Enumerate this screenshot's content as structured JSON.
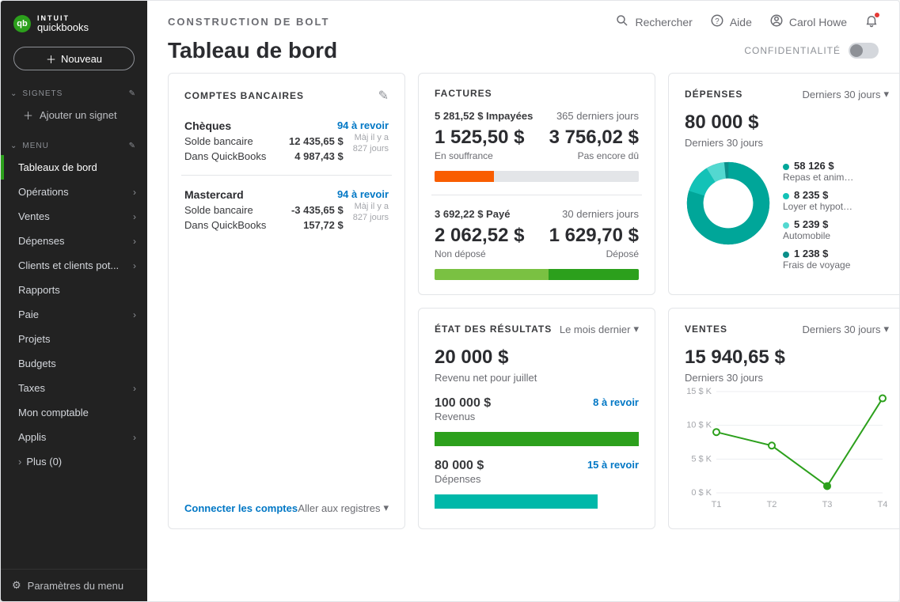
{
  "brand": {
    "line1": "INTUIT",
    "line2": "quickbooks",
    "mark": "qb"
  },
  "sidebar": {
    "new_label": "Nouveau",
    "bookmarks_label": "SIGNETS",
    "add_bookmark": "Ajouter un signet",
    "menu_label": "MENU",
    "items": [
      {
        "label": "Tableaux de bord",
        "chev": false,
        "active": true
      },
      {
        "label": "Opérations",
        "chev": true
      },
      {
        "label": "Ventes",
        "chev": true
      },
      {
        "label": "Dépenses",
        "chev": true
      },
      {
        "label": "Clients et clients pot...",
        "chev": true
      },
      {
        "label": "Rapports",
        "chev": false
      },
      {
        "label": "Paie",
        "chev": true
      },
      {
        "label": "Projets",
        "chev": false
      },
      {
        "label": "Budgets",
        "chev": false
      },
      {
        "label": "Taxes",
        "chev": true
      },
      {
        "label": "Mon comptable",
        "chev": false
      },
      {
        "label": "Applis",
        "chev": true
      }
    ],
    "more": "Plus (0)",
    "settings": "Paramètres du menu"
  },
  "header": {
    "company": "CONSTRUCTION DE BOLT",
    "search": "Rechercher",
    "help": "Aide",
    "user": "Carol Howe",
    "page_title": "Tableau de bord",
    "privacy": "CONFIDENTIALITÉ"
  },
  "invoices": {
    "title": "FACTURES",
    "unpaid_amount": "5 281,52 $ Impayées",
    "unpaid_period": "365 derniers jours",
    "overdue_amount": "1 525,50 $",
    "overdue_label": "En souffrance",
    "notdue_amount": "3 756,02 $",
    "notdue_label": "Pas encore dû",
    "paid_amount": "3 692,22 $ Payé",
    "paid_period": "30 derniers jours",
    "undeposited_amount": "2 062,52 $",
    "undeposited_label": "Non déposé",
    "deposited_amount": "1 629,70 $",
    "deposited_label": "Déposé"
  },
  "expenses": {
    "title": "DÉPENSES",
    "period": "Derniers 30 jours",
    "total": "80 000 $",
    "total_period": "Derniers 30 jours",
    "items": [
      {
        "value": "58 126 $",
        "label": "Repas et anim…",
        "color": "#00a699"
      },
      {
        "value": "8 235 $",
        "label": "Loyer et hypot…",
        "color": "#13c2b7"
      },
      {
        "value": "5 239 $",
        "label": "Automobile",
        "color": "#53d8d0"
      },
      {
        "value": "1 238 $",
        "label": "Frais de voyage",
        "color": "#0b8f8a"
      }
    ]
  },
  "bank": {
    "title": "COMPTES BANCAIRES",
    "accounts": [
      {
        "name": "Chèques",
        "review": "94 à revoir",
        "bank_label": "Solde bancaire",
        "bank_val": "12 435,65 $",
        "qbo_label": "Dans QuickBooks",
        "qbo_val": "4 987,43 $",
        "meta1": "Màj il y a",
        "meta2": "827 jours"
      },
      {
        "name": "Mastercard",
        "review": "94 à revoir",
        "bank_label": "Solde bancaire",
        "bank_val": "-3 435,65 $",
        "qbo_label": "Dans QuickBooks",
        "qbo_val": "157,72 $",
        "meta1": "Màj il y a",
        "meta2": "827 jours"
      }
    ],
    "connect": "Connecter les comptes",
    "goto": "Aller aux registres"
  },
  "pl": {
    "title": "ÉTAT DES RÉSULTATS",
    "period": "Le mois dernier",
    "net": "20 000 $",
    "net_label": "Revenu net pour juillet",
    "income_val": "100 000 $",
    "income_label": "Revenus",
    "income_review": "8 à revoir",
    "expense_val": "80 000 $",
    "expense_label": "Dépenses",
    "expense_review": "15 à revoir"
  },
  "sales": {
    "title": "VENTES",
    "period": "Derniers 30 jours",
    "total": "15 940,65 $",
    "total_period": "Derniers 30 jours"
  },
  "chart_data": [
    {
      "type": "pie",
      "title": "Dépenses — Derniers 30 jours",
      "categories": [
        "Repas et anim…",
        "Loyer et hypot…",
        "Automobile",
        "Frais de voyage"
      ],
      "values": [
        58126,
        8235,
        5239,
        1238
      ],
      "colors": [
        "#00a699",
        "#13c2b7",
        "#53d8d0",
        "#0b8f8a"
      ]
    },
    {
      "type": "bar",
      "title": "Factures — Impayées (365 derniers jours)",
      "categories": [
        "En souffrance",
        "Pas encore dû"
      ],
      "values": [
        1525.5,
        3756.02
      ],
      "colors": [
        "#f95d00",
        "#e3e5e8"
      ]
    },
    {
      "type": "bar",
      "title": "Factures — Payé (30 derniers jours)",
      "categories": [
        "Non déposé",
        "Déposé"
      ],
      "values": [
        2062.52,
        1629.7
      ],
      "colors": [
        "#7ac142",
        "#2ca01c"
      ]
    },
    {
      "type": "bar",
      "title": "État des résultats — Le mois dernier",
      "categories": [
        "Revenus",
        "Dépenses"
      ],
      "values": [
        100000,
        80000
      ],
      "colors": [
        "#2ca01c",
        "#00b8a9"
      ]
    },
    {
      "type": "line",
      "title": "Ventes — Derniers 30 jours",
      "categories": [
        "T1",
        "T2",
        "T3",
        "T4"
      ],
      "series": [
        {
          "name": "Ventes",
          "values": [
            9,
            7,
            1,
            14
          ]
        }
      ],
      "xlabel": "",
      "ylabel": "$ K",
      "ylim": [
        0,
        15
      ],
      "y_ticks": [
        "0 $ K",
        "5 $ K",
        "10 $ K",
        "15 $ K"
      ]
    }
  ]
}
